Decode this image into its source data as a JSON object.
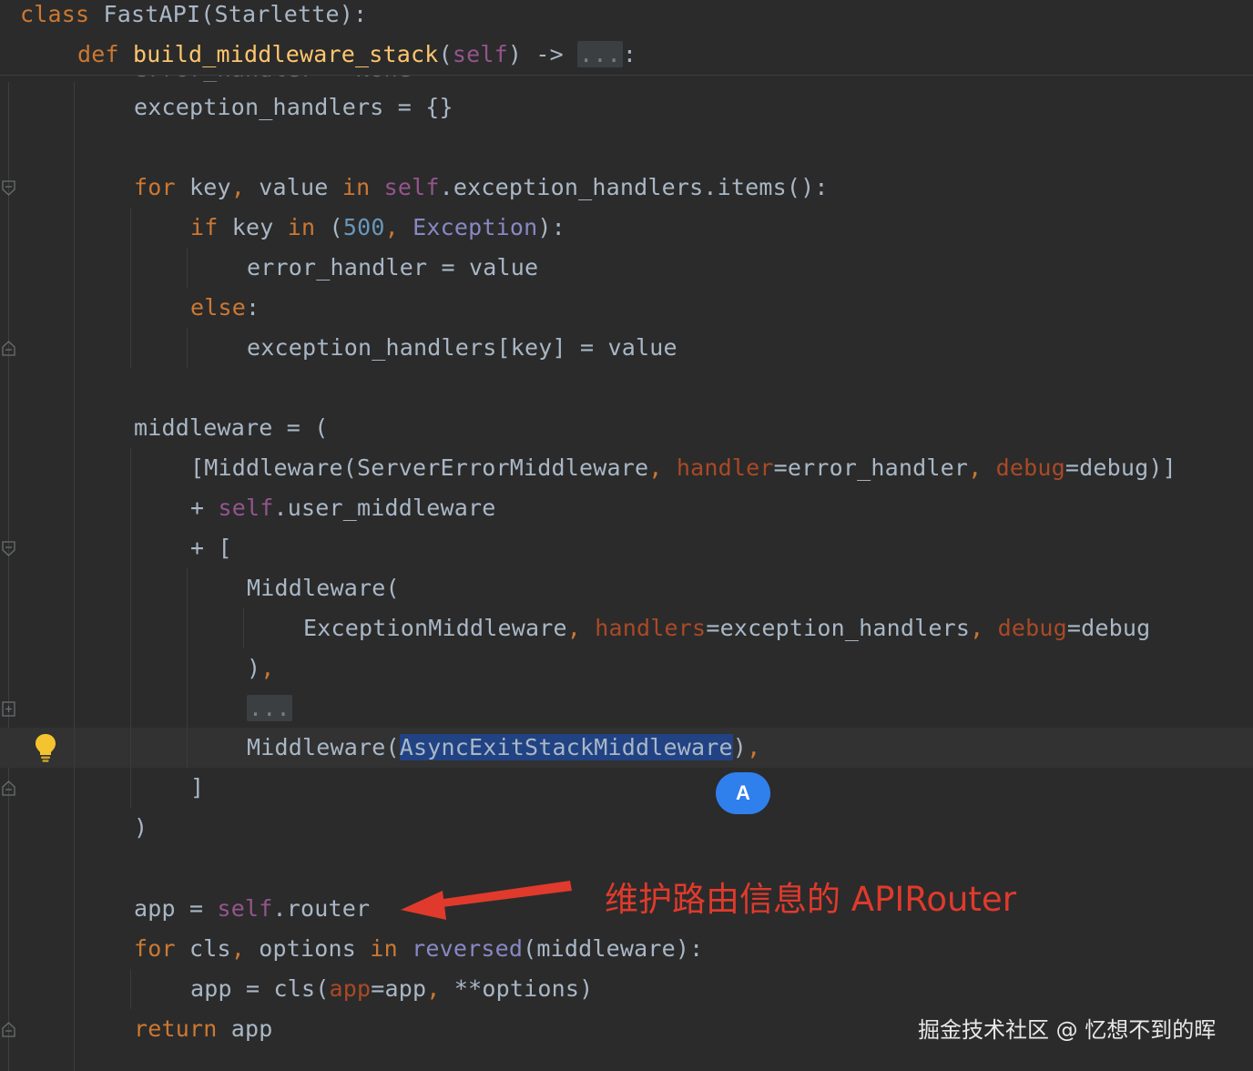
{
  "colors": {
    "background": "#2b2b2b",
    "keyword": "#cc7832",
    "function_name": "#ffc66d",
    "self": "#94558d",
    "number": "#6897bb",
    "builtin": "#8888c6",
    "keyword_argument": "#aa4926",
    "default_text": "#a9b7c6",
    "selection": "#214283",
    "annotation_red": "#e03a2c",
    "badge_blue": "#2f80ed"
  },
  "sticky": {
    "class_kw": "class",
    "class_rest": " FastAPI(Starlette):",
    "def_kw": "def",
    "func_name": "build_middleware_stack",
    "paren_open": "(",
    "self": "self",
    "sig_rest": ") -> ",
    "ellipsis": "...",
    "colon": ":"
  },
  "ghost_line": "error_handler = None",
  "code": {
    "l1": "exception_handlers = {}",
    "l2": {
      "for": "for",
      "a": " key",
      "c1": ",",
      "b": " value ",
      "in": "in",
      "self": " self",
      "rest": ".exception_handlers.items():"
    },
    "l3": {
      "if": "if",
      "a": " key ",
      "in": "in",
      "b": " (",
      "num": "500",
      "comma": ",",
      "exc": " Exception",
      "rest": "):"
    },
    "l4": "error_handler = value",
    "l5": {
      "else": "else",
      "rest": ":"
    },
    "l6": "exception_handlers[key] = value",
    "l7": "middleware = (",
    "l8": {
      "a": "[Middleware(ServerErrorMiddleware",
      "c1": ",",
      "p1": " handler",
      "b": "=error_handler",
      "c2": ",",
      "p2": " debug",
      "c": "=debug)]"
    },
    "l9": {
      "a": "+ ",
      "self": "self",
      "b": ".user_middleware"
    },
    "l10": "+ [",
    "l11": "Middleware(",
    "l12": {
      "a": "ExceptionMiddleware",
      "c1": ",",
      "p1": " handlers",
      "b": "=exception_handlers",
      "c2": ",",
      "p2": " debug",
      "c": "=debug"
    },
    "l13": {
      "a": ")",
      "c": ","
    },
    "l14": "...",
    "l15": {
      "a": "Middleware(",
      "sel": "AsyncExitStackMiddleware",
      "b": ")",
      "c": ","
    },
    "l16": "]",
    "l17": ")",
    "l18": {
      "a": "app = ",
      "self": "self",
      "b": ".router"
    },
    "l19": {
      "for": "for",
      "a": " cls",
      "c1": ",",
      "b": " options ",
      "in": "in",
      "rev": " reversed",
      "rest": "(middleware):"
    },
    "l20": {
      "a": "app = cls(",
      "p": "app",
      "b": "=app",
      "c": ",",
      "d": " **options)"
    },
    "l21": {
      "ret": "return",
      "rest": " app"
    }
  },
  "icons": {
    "bulb": "lightbulb-icon",
    "fold_start": "fold-open-icon",
    "fold_end": "fold-end-icon",
    "fold_plus": "fold-collapsed-icon"
  },
  "badge": "A",
  "annotation": "维护路由信息的 APIRouter",
  "watermark": "掘金技术社区 @ 忆想不到的晖"
}
